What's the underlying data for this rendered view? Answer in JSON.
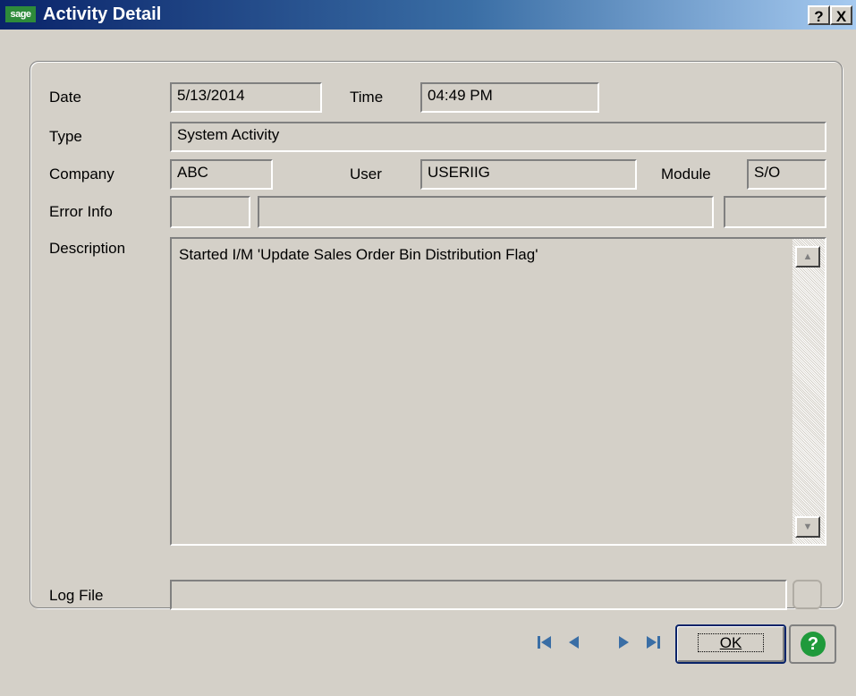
{
  "window": {
    "logo_text": "sage",
    "title": "Activity Detail",
    "help_glyph": "?",
    "close_glyph": "X"
  },
  "form": {
    "date_label": "Date",
    "date_value": "5/13/2014",
    "time_label": "Time",
    "time_value": "04:49 PM",
    "type_label": "Type",
    "type_value": "System Activity",
    "company_label": "Company",
    "company_value": "ABC",
    "user_label": "User",
    "user_value": "USERIIG",
    "module_label": "Module",
    "module_value": "S/O",
    "error_label": "Error Info",
    "description_label": "Description",
    "description_value": "Started I/M 'Update Sales Order Bin Distribution Flag'",
    "logfile_label": "Log File"
  },
  "footer": {
    "ok_label": "OK",
    "help_glyph": "?"
  },
  "icons": {
    "nav": [
      "first-record-icon",
      "previous-record-icon",
      "next-record-icon",
      "last-record-icon"
    ],
    "accent": "#3a6ea5",
    "help_color": "#1f9a3b"
  }
}
